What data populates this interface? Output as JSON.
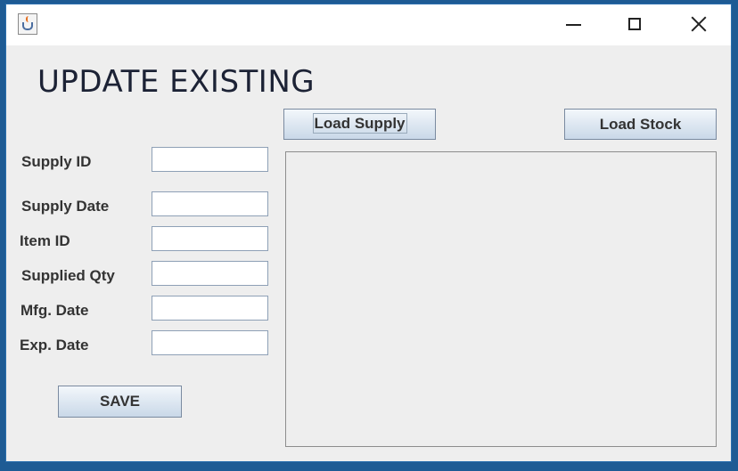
{
  "window": {
    "title": "",
    "controls": {
      "minimize": "minimize-icon",
      "maximize": "maximize-icon",
      "close": "close-icon"
    }
  },
  "form": {
    "heading": "UPDATE EXISTING",
    "fields": [
      {
        "label": "Supply ID",
        "value": ""
      },
      {
        "label": "Supply Date",
        "value": ""
      },
      {
        "label": "Item ID",
        "value": ""
      },
      {
        "label": "Supplied Qty",
        "value": ""
      },
      {
        "label": "Mfg. Date",
        "value": ""
      },
      {
        "label": "Exp. Date",
        "value": ""
      }
    ],
    "save_label": "SAVE"
  },
  "toolbar": {
    "load_supply_label": "Load Supply",
    "load_stock_label": "Load Stock"
  },
  "colors": {
    "window_bg": "#eeeeee",
    "titlebar_bg": "#ffffff",
    "desktop_bg": "#1e5b94",
    "button_gradient_top": "#f3f7fb",
    "button_gradient_bottom": "#c9d8e8"
  }
}
